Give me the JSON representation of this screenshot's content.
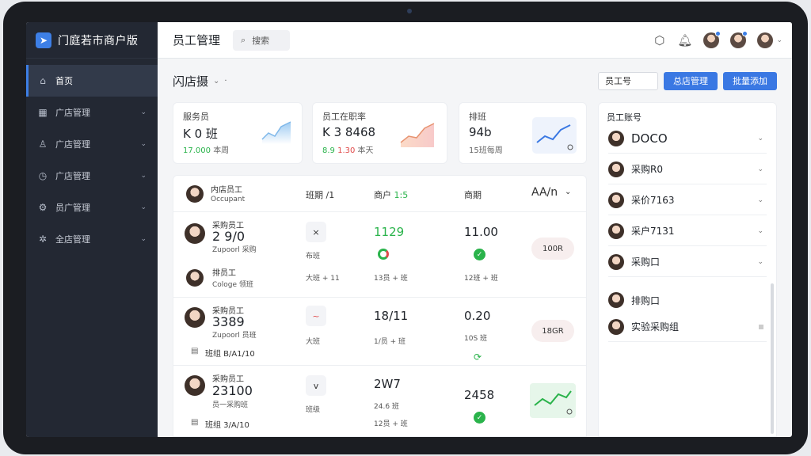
{
  "app": {
    "brand": "门庭若市商户版"
  },
  "sidebar": {
    "items": [
      {
        "label": "首页",
        "icon": "home-icon"
      },
      {
        "label": "广店管理",
        "icon": "grid-icon"
      },
      {
        "label": "广店管理",
        "icon": "user-icon"
      },
      {
        "label": "广店管理",
        "icon": "clock-icon"
      },
      {
        "label": "员广管理",
        "icon": "settings-icon"
      },
      {
        "label": "全店管理",
        "icon": "gear-icon"
      }
    ]
  },
  "topbar": {
    "title": "员工管理",
    "search_label": "搜索"
  },
  "store": {
    "name": "闪店摄"
  },
  "actions": {
    "employee_input": "员工号",
    "btn_primary": "总店管理",
    "btn_secondary": "批量添加"
  },
  "stats": [
    {
      "label": "服务员",
      "value": "K 0 班",
      "sub_green": "17.000",
      "sub_text": "本周"
    },
    {
      "label": "员工在职率",
      "value": "K 3 8468",
      "sub_green": "8.9",
      "sub_red": "1.30",
      "sub_text": "本天"
    },
    {
      "label": "排班",
      "value": "94b",
      "sub_text": "15班每周"
    }
  ],
  "table": {
    "headers": {
      "name": "内店员工",
      "name_sub": "Occupant",
      "col2": "班期 /1",
      "col3": "商户",
      "col3_green": "1:5",
      "col4": "商期",
      "col5": "AA/n"
    },
    "rows": [
      {
        "title": "采购员工",
        "big": "2 9/0",
        "sub": "Zupoorl 采购",
        "icon": "×",
        "icon_label": "布班",
        "count": "1129",
        "count_green": true,
        "value": "11.00",
        "pill": "100R",
        "extra_title": "排员工",
        "extra_sub": "Cologe 领班",
        "extra_c2": "大班 + 11",
        "extra_c3": "13员 + 班",
        "extra_c4": "12班 + 班"
      },
      {
        "title": "采购员工",
        "big": "3389",
        "sub": "Zupoorl 员班",
        "icon": "~",
        "icon_label": "大班",
        "count": "18/11",
        "count_label": "1/员 + 班",
        "value": "0.20",
        "value_label": "10S 班",
        "pill": "18GR",
        "footer": "班组 B/A1/10"
      },
      {
        "title": "采购员工",
        "big": "23100",
        "sub": "员一采购班",
        "icon": "v",
        "icon_label": "班级",
        "count": "2W7",
        "count_label": "24.6 班",
        "value": "2458",
        "footer": "班组 3/A/10",
        "footer2": "12员 + 班"
      }
    ]
  },
  "panel": {
    "title": "员工账号",
    "employees": [
      {
        "name": "DOCO"
      },
      {
        "name": "采购R0"
      },
      {
        "name": "采价7163"
      },
      {
        "name": "采户7131"
      },
      {
        "name": "采购口"
      },
      {
        "name": "排购口"
      },
      {
        "name": "实验采购组"
      }
    ]
  },
  "colors": {
    "accent": "#3a78e3",
    "sidebar": "#232833",
    "green": "#2ab34b"
  }
}
